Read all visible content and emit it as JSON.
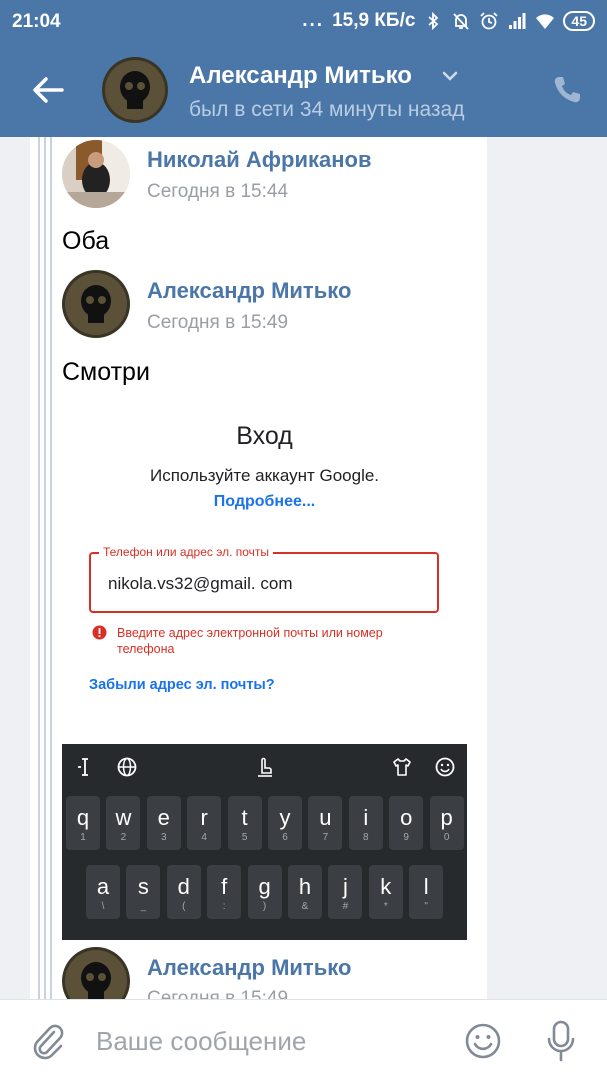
{
  "status_bar": {
    "time": "21:04",
    "dots": "...",
    "speed": "15,9 КБ/с",
    "battery": "45"
  },
  "header": {
    "name": "Александр Митько",
    "status": "был в сети 34 минуты назад"
  },
  "messages": [
    {
      "author": "Николай Африканов",
      "time": "Сегодня в 15:44",
      "text": "Оба"
    },
    {
      "author": "Александр Митько",
      "time": "Сегодня в 15:49",
      "text": "Смотри"
    },
    {
      "author": "Александр Митько",
      "time": "Сегодня в 15:49",
      "text": ""
    }
  ],
  "screenshot": {
    "title": "Вход",
    "subtitle": "Используйте аккаунт Google.",
    "more_link": "Подробнее...",
    "field_label": "Телефон или адрес эл. почты",
    "field_value": "nikola.vs32@gmail. com",
    "error": "Введите адрес электронной почты или номер телефона",
    "forgot_link": "Забыли адрес эл. почты?",
    "keyboard": {
      "row1": [
        {
          "k": "q",
          "s": "1"
        },
        {
          "k": "w",
          "s": "2"
        },
        {
          "k": "e",
          "s": "3"
        },
        {
          "k": "r",
          "s": "4"
        },
        {
          "k": "t",
          "s": "5"
        },
        {
          "k": "y",
          "s": "6"
        },
        {
          "k": "u",
          "s": "7"
        },
        {
          "k": "i",
          "s": "8"
        },
        {
          "k": "o",
          "s": "9"
        },
        {
          "k": "p",
          "s": "0"
        }
      ],
      "row2": [
        {
          "k": "a",
          "s": "\\"
        },
        {
          "k": "s",
          "s": "_"
        },
        {
          "k": "d",
          "s": "("
        },
        {
          "k": "f",
          "s": ":"
        },
        {
          "k": "g",
          "s": ")"
        },
        {
          "k": "h",
          "s": "&"
        },
        {
          "k": "j",
          "s": "#"
        },
        {
          "k": "k",
          "s": "*"
        },
        {
          "k": "l",
          "s": "\""
        }
      ]
    }
  },
  "input": {
    "placeholder": "Ваше сообщение"
  },
  "colors": {
    "header_bg": "#4a76a8",
    "name_link": "#4a76a8",
    "error_red": "#d93025",
    "google_blue": "#1a73e8"
  }
}
